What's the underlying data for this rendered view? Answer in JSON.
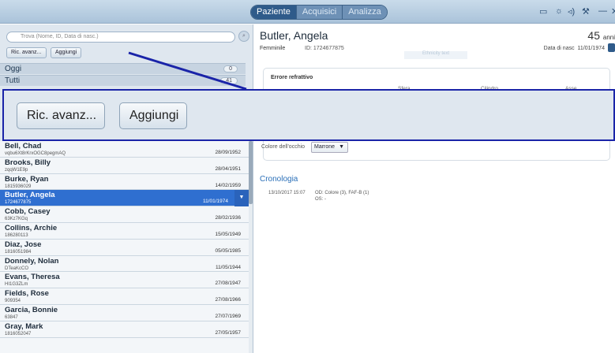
{
  "topbar": {
    "tabs": [
      {
        "label": "Paziente",
        "active": true
      },
      {
        "label": "Acquisici",
        "active": false
      },
      {
        "label": "Analizza",
        "active": false
      }
    ],
    "system_icons": [
      "monitor-icon",
      "brightness-icon",
      "volume-icon",
      "wrench-icon",
      "minimize-icon",
      "close-icon"
    ]
  },
  "sidebar": {
    "search_placeholder": "Trova (Nome, ID, Data di nasc.)",
    "ricerca_label": "Ric. avanz...",
    "aggiungi_label": "Aggiungi",
    "groups": [
      {
        "label": "Oggi",
        "count": "0"
      },
      {
        "label": "Tutti",
        "count": "41"
      }
    ],
    "patients": [
      {
        "name": "Bell, Chad",
        "id": "vqbu6Xt8rKrxOGC8pegmAQ",
        "dob": "28/09/1952"
      },
      {
        "name": "Brooks, Billy",
        "id": "zqqW1E9p",
        "dob": "28/04/1951"
      },
      {
        "name": "Burke, Ryan",
        "id": "1815936029",
        "dob": "14/02/1959"
      },
      {
        "name": "Butler, Angela",
        "id": "1724677875",
        "dob": "11/01/1974",
        "selected": true
      },
      {
        "name": "Cobb, Casey",
        "id": "63Kz7KGq",
        "dob": "28/02/1936"
      },
      {
        "name": "Collins, Archie",
        "id": "186280113",
        "dob": "15/05/1949"
      },
      {
        "name": "Diaz, Jose",
        "id": "1816051984",
        "dob": "05/05/1985"
      },
      {
        "name": "Donnely, Nolan",
        "id": "DTeaKcCO",
        "dob": "11/05/1944"
      },
      {
        "name": "Evans, Theresa",
        "id": "HI1G3ZLm",
        "dob": "27/08/1947"
      },
      {
        "name": "Fields, Rose",
        "id": "909354",
        "dob": "27/08/1966"
      },
      {
        "name": "Garcia, Bonnie",
        "id": "63847",
        "dob": "27/07/1969"
      },
      {
        "name": "Gray, Mark",
        "id": "1816052047",
        "dob": "27/05/1957"
      }
    ]
  },
  "patient": {
    "name": "Butler, Angela",
    "age": "45",
    "age_unit": "anni",
    "gender": "Femminile",
    "id_label": "ID: 1724677875",
    "dob_label": "Data di nasc",
    "dob": "11/01/1974",
    "ghost_text": "Ethnicity text"
  },
  "refraction": {
    "title": "Errore refrattivo",
    "columns": [
      "Sfera",
      "Cilindro",
      "Asse"
    ]
  },
  "eye_color": {
    "label": "Colore dell'occhio",
    "value": "Marrone"
  },
  "history": {
    "title": "Cronologia",
    "entries": [
      {
        "date": "13/10/2017 15:07",
        "od": "OD: Colore (3), FAF-B (1)",
        "os": "OS: -"
      }
    ]
  },
  "colors": {
    "selection": "#2f6fd0",
    "accent": "#2a6fb8",
    "callout": "#1a24a8"
  }
}
